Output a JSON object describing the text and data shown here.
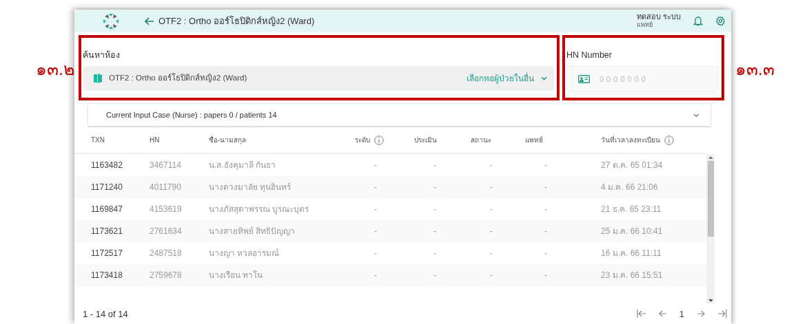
{
  "header": {
    "title": "OTF2 : Ortho ออร์โธปิดิกส์หญิง2 (Ward)",
    "user_name": "ทดสอบ ระบบ",
    "user_role": "แพทย์"
  },
  "annotations": [
    {
      "label": "๑๓.๒"
    },
    {
      "label": "๑๓.๓"
    }
  ],
  "room_search": {
    "label": "ค้นหาห้อง",
    "value": "OTF2 : Ortho ออร์โธปิดิกส์หญิง2 (Ward)",
    "other_ward_link": "เลือกหอผู้ป่วยในอื่น"
  },
  "hn_search": {
    "label": "HN Number",
    "placeholder": "0000000"
  },
  "case_panel": {
    "title": "Current Input Case (Nurse) : papers 0 / patients 14",
    "expanded": false
  },
  "table": {
    "columns": [
      {
        "label": "TXN",
        "info": false
      },
      {
        "label": "HN",
        "info": false
      },
      {
        "label": "ชื่อ-นามสกุล",
        "info": false
      },
      {
        "label": "ระดับ",
        "info": true
      },
      {
        "label": "ประเมิน",
        "info": false
      },
      {
        "label": "สถานะ",
        "info": false
      },
      {
        "label": "แพทย์",
        "info": false
      },
      {
        "label": "วันที่เวลาลงทะเบียน",
        "info": true
      }
    ],
    "rows": [
      {
        "txn": "1163482",
        "hn": "3467114",
        "name": "น.ส.อังคุมาลี กันธา",
        "level": "-",
        "assessment": "-",
        "status": "-",
        "doctor": "-",
        "registered": "27 ต.ค. 65 01:34"
      },
      {
        "txn": "1171240",
        "hn": "4011790",
        "name": "นางดวงมาลัย ทุนอินทร์",
        "level": "-",
        "assessment": "-",
        "status": "-",
        "doctor": "-",
        "registered": "4 ม.ค. 66 21:06"
      },
      {
        "txn": "1169847",
        "hn": "4153619",
        "name": "นางภัสสุดาพรรณ บูรณะบุตร",
        "level": "-",
        "assessment": "-",
        "status": "-",
        "doctor": "-",
        "registered": "21 ธ.ค. 65 23:11"
      },
      {
        "txn": "1173621",
        "hn": "2761634",
        "name": "นางสายทิพย์ สิทธิปัญญา",
        "level": "-",
        "assessment": "-",
        "status": "-",
        "doctor": "-",
        "registered": "25 ม.ค. 66 10:41"
      },
      {
        "txn": "1172517",
        "hn": "2487518",
        "name": "นางญา หวลอารมณ์",
        "level": "-",
        "assessment": "-",
        "status": "-",
        "doctor": "-",
        "registered": "16 ม.ค. 66 11:11"
      },
      {
        "txn": "1173418",
        "hn": "2759678",
        "name": "นางเรือน ทาโน",
        "level": "-",
        "assessment": "-",
        "status": "-",
        "doctor": "-",
        "registered": "23 ม.ค. 66 15:51"
      }
    ]
  },
  "pagination": {
    "range": "1 - 14 of 14",
    "page": "1"
  }
}
